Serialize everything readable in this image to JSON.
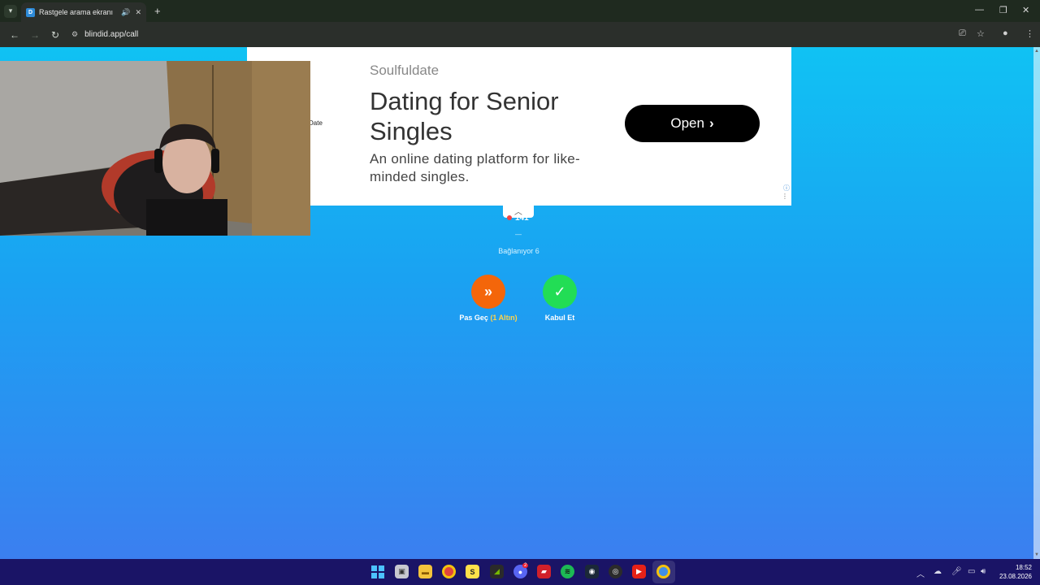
{
  "browser": {
    "tab": {
      "favicon": "D",
      "title": "Rastgele arama ekranı"
    },
    "url": "blindid.app/call"
  },
  "ad": {
    "brand": "Soulfuldate",
    "headline": "Dating for Senior Singles",
    "description": "An online dating platform for like-minded singles.",
    "cta": "Open",
    "fragment_text": "Date"
  },
  "call": {
    "count": "141",
    "dash": "—",
    "status": "Bağlanıyor 6",
    "skip": {
      "label": "Pas Geç",
      "cost": "(1 Altın)"
    },
    "accept": {
      "label": "Kabul Et"
    }
  },
  "colors": {
    "skip": "#f4660a",
    "accept": "#22dd55"
  },
  "taskbar": {
    "icons": [
      "windows-start",
      "task-view",
      "file-explorer",
      "chrome",
      "s-app",
      "nvidia",
      "discord",
      "red-app",
      "spotify",
      "steam",
      "obs",
      "youtube",
      "chrome-active"
    ],
    "discord_badge": "2",
    "time": "18:52",
    "date": "23.08.2026"
  }
}
